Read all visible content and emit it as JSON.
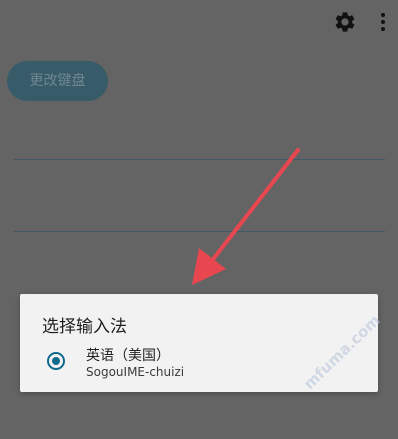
{
  "toolbar": {
    "settings_icon": "gear-icon",
    "more_icon": "more-vert-icon"
  },
  "main": {
    "change_keyboard_label": "更改键盘"
  },
  "dialog": {
    "title": "选择输入法",
    "options": [
      {
        "label": "英语（美国）",
        "sublabel": "SogouIME-chuizi",
        "selected": true
      }
    ]
  },
  "colors": {
    "scrim": "#646464",
    "accent": "#0f6a8b",
    "arrow": "#e8474f",
    "dialog_bg": "#f2f2f3"
  },
  "watermark": "mfuma.com"
}
